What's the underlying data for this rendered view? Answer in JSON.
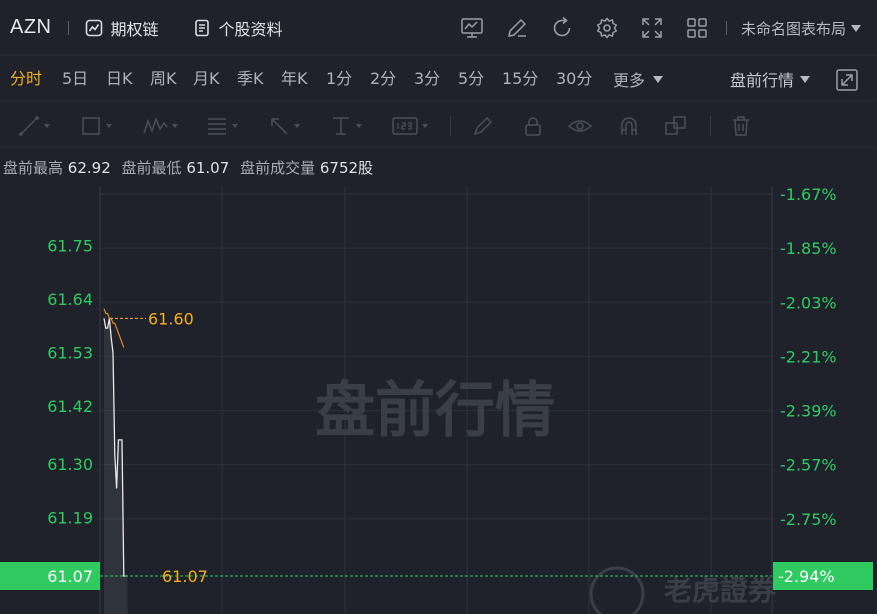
{
  "header": {
    "symbol": "AZN",
    "options_chain": "期权链",
    "stock_profile": "个股资料",
    "layout_name": "未命名图表布局"
  },
  "periods": [
    "分时",
    "5日",
    "日K",
    "周K",
    "月K",
    "季K",
    "年K",
    "1分",
    "2分",
    "3分",
    "5分",
    "15分",
    "30分"
  ],
  "active_period": "分时",
  "more_label": "更多",
  "session_label": "盘前行情",
  "info": {
    "high_label": "盘前最高",
    "high": "62.92",
    "low_label": "盘前最低",
    "low": "61.07",
    "volume_label": "盘前成交量",
    "volume": "6752股"
  },
  "watermark": "盘前行情",
  "logo_text": "老虎證券",
  "colors": {
    "accent": "#f3b01c",
    "green": "#2fcb61",
    "price_line": "#e8e8e8",
    "avg_line": "#e08a2c"
  },
  "chart_data": {
    "type": "line",
    "y_ticks": [
      "61.75",
      "61.64",
      "61.53",
      "61.42",
      "61.30",
      "61.19",
      "61.07"
    ],
    "y_tick_values": [
      61.75,
      61.64,
      61.53,
      61.42,
      61.3,
      61.19,
      61.07
    ],
    "pct_ticks": [
      "-1.67%",
      "-1.85%",
      "-2.03%",
      "-2.21%",
      "-2.39%",
      "-2.57%",
      "-2.75%",
      "-2.94%"
    ],
    "pct_tick_values": [
      -1.67,
      -1.85,
      -2.03,
      -2.21,
      -2.39,
      -2.57,
      -2.75,
      -2.94
    ],
    "ylim": [
      61.07,
      61.86
    ],
    "current_price": "61.07",
    "current_pct": "-2.94%",
    "ref_price": "61.60",
    "ref_value": 61.6,
    "series": [
      {
        "name": "",
        "role": "price",
        "x": [
          0,
          1,
          2,
          3,
          4,
          5,
          6,
          7,
          8,
          9,
          10,
          11,
          12,
          13
        ],
        "values": [
          61.6,
          61.58,
          61.58,
          61.6,
          61.56,
          61.53,
          61.32,
          61.25,
          61.35,
          61.35,
          61.35,
          61.07,
          61.07,
          61.07
        ]
      },
      {
        "name": "",
        "role": "average",
        "x": [
          0,
          1,
          2,
          3,
          4,
          5,
          6,
          7,
          8,
          9,
          10,
          11
        ],
        "values": [
          61.62,
          61.61,
          61.61,
          61.6,
          61.6,
          61.59,
          61.59,
          61.58,
          61.57,
          61.56,
          61.55,
          61.54
        ]
      }
    ]
  }
}
